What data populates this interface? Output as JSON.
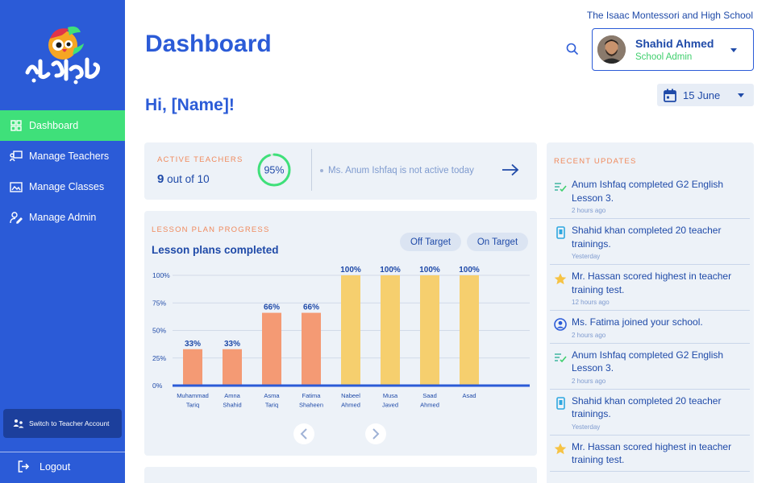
{
  "header": {
    "title": "Dashboard",
    "school_name": "The Isaac Montessori and High School",
    "greeting": "Hi, [Name]!"
  },
  "logo": {
    "text": "تعلیم آباد"
  },
  "profile": {
    "name": "Shahid Ahmed",
    "role": "School Admin"
  },
  "date_picker": {
    "value": "15 June"
  },
  "sidebar": {
    "items": [
      {
        "label": "Dashboard",
        "icon": "grid-icon",
        "active": true
      },
      {
        "label": "Manage Teachers",
        "icon": "teacher-board-icon",
        "active": false
      },
      {
        "label": "Manage Classes",
        "icon": "classroom-icon",
        "active": false
      },
      {
        "label": "Manage Admin",
        "icon": "user-edit-icon",
        "active": false
      }
    ],
    "switch_account": "Switch to Teacher Account",
    "logout": "Logout"
  },
  "active_teachers": {
    "label": "ACTIVE TEACHERS",
    "count": "9",
    "count_suffix": " out of 10",
    "percent_text": "95%",
    "percent": 95,
    "note": "Ms. Anum Ishfaq is not active today"
  },
  "lesson_plan": {
    "label": "LESSON PLAN PROGRESS",
    "title": "Lesson plans completed",
    "off_target": "Off Target",
    "on_target": "On Target"
  },
  "chart_data": {
    "type": "bar",
    "categories": [
      "Muhammad Tariq",
      "Amna Shahid",
      "Asma Tariq",
      "Fatima Shaheen",
      "Nabeel Ahmed",
      "Musa Javed",
      "Saad Ahmed",
      "Asad"
    ],
    "category_lines": [
      [
        "Muhammad",
        "Tariq"
      ],
      [
        "Amna",
        "Shahid"
      ],
      [
        "Asma",
        "Tariq"
      ],
      [
        "Fatima",
        "Shaheen"
      ],
      [
        "Nabeel",
        "Ahmed"
      ],
      [
        "Musa",
        "Javed"
      ],
      [
        "Saad",
        "Ahmed"
      ],
      [
        "Asad"
      ]
    ],
    "values": [
      33,
      33,
      66,
      66,
      100,
      100,
      100,
      100
    ],
    "value_labels": [
      "33%",
      "33%",
      "66%",
      "66%",
      "100%",
      "100%",
      "100%",
      "100%"
    ],
    "status": [
      "off",
      "off",
      "off",
      "off",
      "on",
      "on",
      "on",
      "on"
    ],
    "yticks": [
      "0%",
      "25%",
      "50%",
      "75%",
      "100%"
    ],
    "ylim": [
      0,
      100
    ],
    "grid": true,
    "colors": {
      "off": "#f49a74",
      "on": "#f6cf6e",
      "axis": "#2b5bd7",
      "grid": "#c9d3e3"
    }
  },
  "recent_updates": {
    "label": "RECENT UPDATES",
    "items": [
      {
        "icon": "checklist-icon",
        "text": "Anum Ishfaq completed G2 English Lesson 3.",
        "time": "2 hours ago"
      },
      {
        "icon": "mobile-icon",
        "text": "Shahid khan completed 20 teacher trainings.",
        "time": "Yesterday"
      },
      {
        "icon": "star-icon",
        "text": "Mr. Hassan scored highest in teacher training test.",
        "time": "12 hours ago"
      },
      {
        "icon": "user-circle-icon",
        "text": "Ms. Fatima joined your school.",
        "time": "2 hours ago"
      },
      {
        "icon": "checklist-icon",
        "text": "Anum Ishfaq completed G2 English Lesson 3.",
        "time": "2 hours ago"
      },
      {
        "icon": "mobile-icon",
        "text": "Shahid khan completed 20 teacher trainings.",
        "time": "Yesterday"
      },
      {
        "icon": "star-icon",
        "text": "Mr. Hassan scored highest in teacher training test.",
        "time": ""
      }
    ]
  }
}
